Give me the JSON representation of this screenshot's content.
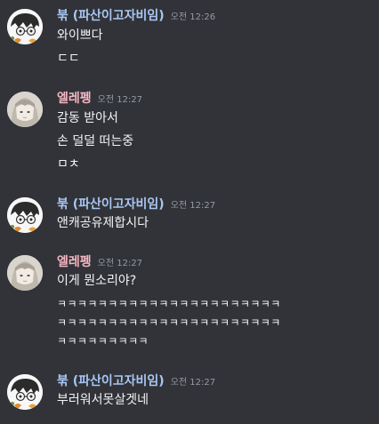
{
  "colors": {
    "background": "#313338",
    "username_buk": "#a9c6f2",
    "username_ellepeng": "#f4b6c2",
    "timestamp": "#949ba4",
    "message_text": "#f2f3f5"
  },
  "messages": [
    {
      "author": "붂 (파산이고자비임)",
      "time": "오전 12:26",
      "lines": [
        "와이쁘다",
        "ㄷㄷ"
      ]
    },
    {
      "author": "엘레펭",
      "time": "오전 12:27",
      "lines": [
        "감동 받아서",
        "손 덜덜 떠는중",
        "ㅁㅊ"
      ]
    },
    {
      "author": "붂 (파산이고자비임)",
      "time": "오전 12:27",
      "lines": [
        "앤캐공유제합시다"
      ]
    },
    {
      "author": "엘레펭",
      "time": "오전 12:27",
      "lines": [
        "이게 뭔소리야?",
        "ㅋㅋㅋㅋㅋㅋㅋㅋㅋㅋㅋㅋㅋㅋㅋㅋㅋㅋㅋㅋㅋㅋ",
        "ㅋㅋㅋㅋㅋㅋㅋㅋㅋㅋㅋㅋㅋㅋㅋㅋㅋㅋㅋㅋㅋㅋ",
        "ㅋㅋㅋㅋㅋㅋㅋㅋㅋ"
      ]
    },
    {
      "author": "붂 (파산이고자비임)",
      "time": "오전 12:27",
      "lines": [
        "부러워서못살겟네"
      ]
    }
  ]
}
